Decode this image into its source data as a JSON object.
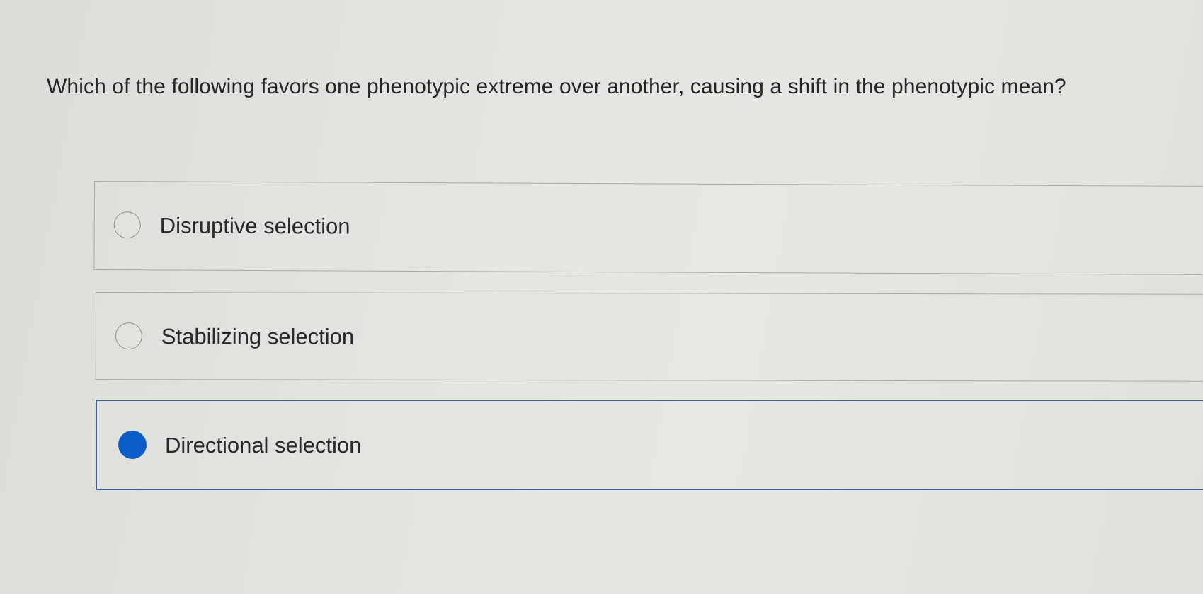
{
  "question": {
    "text": "Which of the following favors one phenotypic extreme over another, causing a shift in the phenotypic mean?"
  },
  "options": [
    {
      "label": "Disruptive selection",
      "selected": false
    },
    {
      "label": "Stabilizing selection",
      "selected": false
    },
    {
      "label": "Directional selection",
      "selected": true
    }
  ],
  "colors": {
    "selected_radio": "#0b5cc7",
    "selected_border": "#3b5f8f",
    "unselected_border": "#a9a9a6",
    "background": "#e3e3df"
  }
}
